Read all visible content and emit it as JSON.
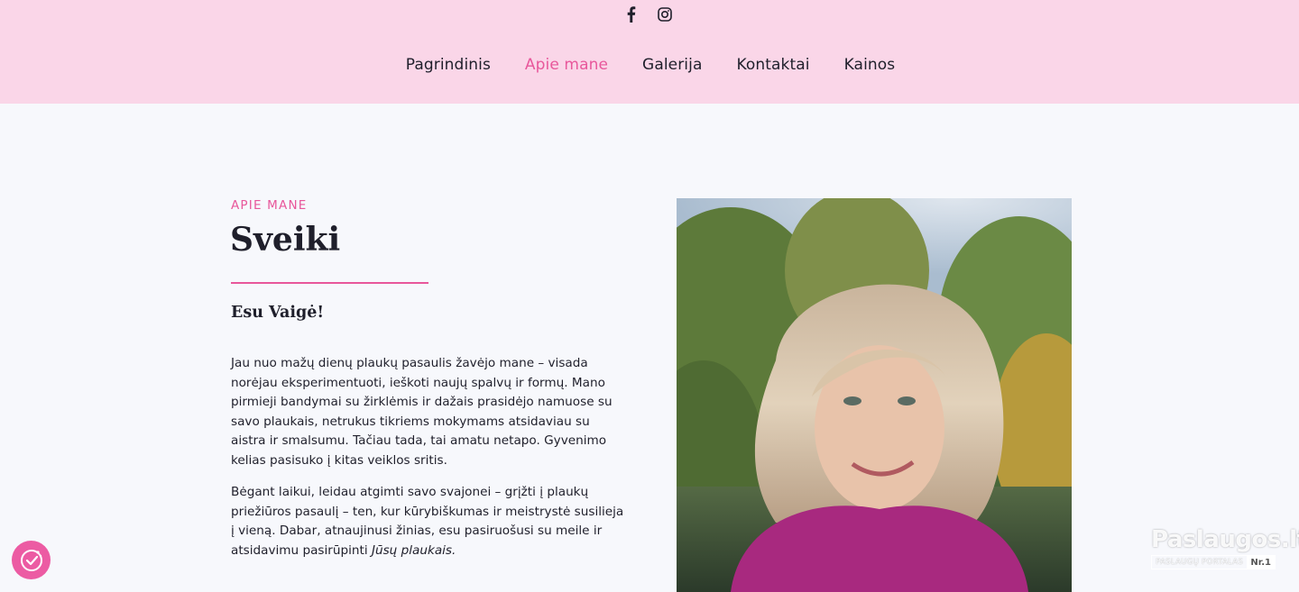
{
  "header": {
    "social": [
      {
        "icon": "facebook-icon"
      },
      {
        "icon": "instagram-icon"
      }
    ],
    "nav": [
      {
        "label": "Pagrindinis",
        "active": false
      },
      {
        "label": "Apie mane",
        "active": true
      },
      {
        "label": "Galerija",
        "active": false
      },
      {
        "label": "Kontaktai",
        "active": false
      },
      {
        "label": "Kainos",
        "active": false
      }
    ]
  },
  "about": {
    "eyebrow": "APIE MANE",
    "title": "Sveiki",
    "subtitle": "Esu Vaigė!",
    "paragraph1": " Jau nuo mažų dienų plaukų pasaulis žavėjo mane – visada norėjau eksperimentuoti, ieškoti naujų spalvų ir formų. Mano pirmieji bandymai su žirklėmis ir dažais prasidėjo namuose su savo plaukais, netrukus tikriems mokymams atsidaviau su aistra ir smalsumu. Tačiau tada, tai amatu netapo. Gyvenimo kelias pasisuko į kitas veiklos sritis.",
    "paragraph2_main": "Bėgant laikui, leidau atgimti savo svajonei – grįžti į plaukų priežiūros pasaulį – ten, kur kūrybiškumas ir meistrystė susilieja į vieną. Dabar, atnaujinusi žinias, esu pasiruošusi su meile ir atsidavimu pasirūpinti ",
    "paragraph2_em": "Jūsų plaukais."
  },
  "badge": {
    "logo": "Paslaugos.lt",
    "subtitle": "PASLAUGŲ PORTALAS",
    "number": "Nr.1"
  },
  "colors": {
    "header_bg": "#fad6e8",
    "accent": "#e8579b",
    "page_bg": "#f7f8fc",
    "text": "#1f1f2b"
  }
}
